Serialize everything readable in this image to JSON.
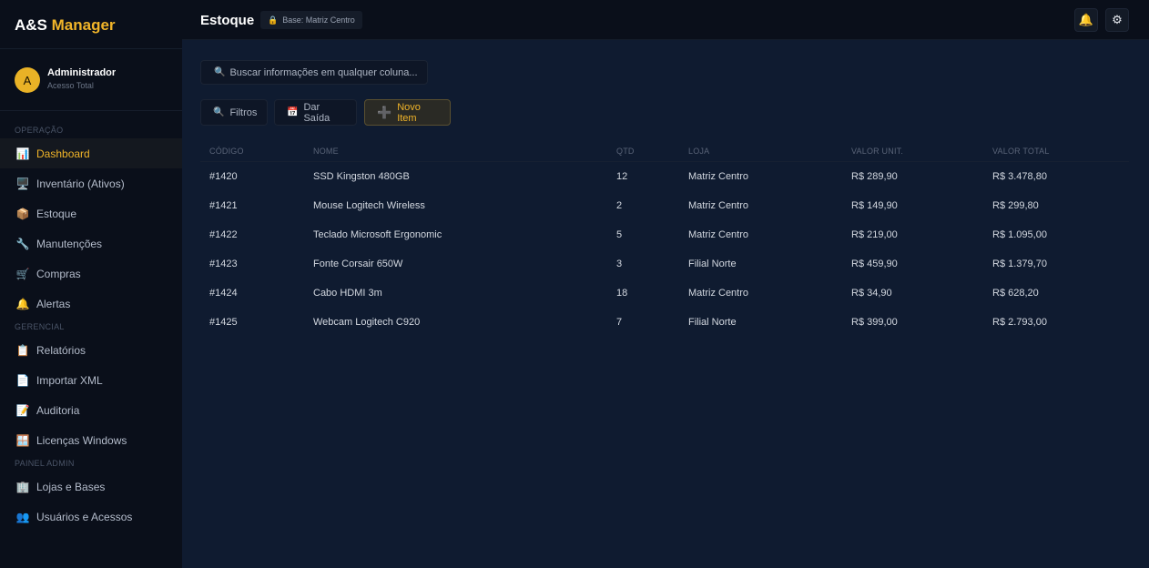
{
  "brand": {
    "part1": "A&S",
    "part2": "Manager"
  },
  "user": {
    "initial": "A",
    "name": "Administrador",
    "role": "Acesso Total"
  },
  "sidebar": {
    "sections": [
      {
        "title": "OPERAÇÃO",
        "items": [
          {
            "label": "Dashboard",
            "icon": "chart-icon",
            "glyph": "📊",
            "active": true
          },
          {
            "label": "Inventário (Ativos)",
            "icon": "monitor-icon",
            "glyph": "🖥️"
          },
          {
            "label": "Estoque",
            "icon": "box-icon",
            "glyph": "📦"
          },
          {
            "label": "Manutenções",
            "icon": "wrench-icon",
            "glyph": "🔧"
          },
          {
            "label": "Compras",
            "icon": "cart-icon",
            "glyph": "🛒"
          },
          {
            "label": "Alertas",
            "icon": "bell-icon",
            "glyph": "🔔"
          }
        ]
      },
      {
        "title": "GERENCIAL",
        "items": [
          {
            "label": "Relatórios",
            "icon": "clipboard-icon",
            "glyph": "📋"
          },
          {
            "label": "Importar XML",
            "icon": "document-icon",
            "glyph": "📄"
          },
          {
            "label": "Auditoria",
            "icon": "memo-icon",
            "glyph": "📝"
          },
          {
            "label": "Licenças Windows",
            "icon": "windows-icon",
            "glyph": "🪟"
          }
        ]
      },
      {
        "title": "PAINEL ADMIN",
        "items": [
          {
            "label": "Lojas e Bases",
            "icon": "building-icon",
            "glyph": "🏢"
          },
          {
            "label": "Usuários e Acessos",
            "icon": "users-icon",
            "glyph": "👥"
          }
        ]
      }
    ]
  },
  "header": {
    "title": "Estoque",
    "base_label": "Base: Matriz Centro"
  },
  "toolbar": {
    "search_placeholder": "Buscar informações em qualquer coluna...",
    "filter_label": "Filtros",
    "exit_label": "Dar Saída",
    "new_label": "Novo Item"
  },
  "table": {
    "headers": [
      "CÓDIGO",
      "NOME",
      "QTD",
      "LOJA",
      "VALOR UNIT.",
      "VALOR TOTAL"
    ],
    "rows": [
      [
        "#1420",
        "SSD Kingston 480GB",
        "12",
        "Matriz Centro",
        "R$ 289,90",
        "R$ 3.478,80"
      ],
      [
        "#1421",
        "Mouse Logitech Wireless",
        "2",
        "Matriz Centro",
        "R$ 149,90",
        "R$ 299,80"
      ],
      [
        "#1422",
        "Teclado Microsoft Ergonomic",
        "5",
        "Matriz Centro",
        "R$ 219,00",
        "R$ 1.095,00"
      ],
      [
        "#1423",
        "Fonte Corsair 650W",
        "3",
        "Filial Norte",
        "R$ 459,90",
        "R$ 1.379,70"
      ],
      [
        "#1424",
        "Cabo HDMI 3m",
        "18",
        "Matriz Centro",
        "R$ 34,90",
        "R$ 628,20"
      ],
      [
        "#1425",
        "Webcam Logitech C920",
        "7",
        "Filial Norte",
        "R$ 399,00",
        "R$ 2.793,00"
      ]
    ]
  },
  "colors": {
    "accent": "#f0b429",
    "background": "#0f1b30",
    "sidebar": "#0a0f1a"
  }
}
